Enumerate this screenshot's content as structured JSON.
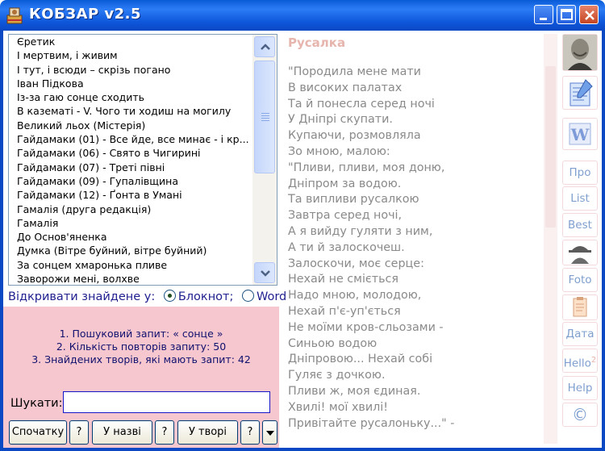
{
  "window": {
    "title": "КОБЗАР v2.5"
  },
  "list": {
    "items": [
      "Єретик",
      "І мертвим, і живим",
      "І тут, і всюди – скрізь погано",
      "Іван Підкова",
      "Із-за гаю сонце сходить",
      "В казематі - V. Чого ти ходиш на могилу",
      "Великий льох (Містерія)",
      "Гайдамаки (01) - Все йде, все минає - і кр...",
      "Гайдамаки (06) - Свято в Чигирині",
      "Гайдамаки (07) - Треті півні",
      "Гайдамаки (09) - Гупалівщина",
      "Гайдамаки (12) - Ґонта в Умані",
      "Гамалія (друга редакція)",
      "Гамалія",
      "До Основ'яненка",
      "Думка (Вітре буйний, вітре буйний)",
      "За сонцем хмаронька пливе",
      "Заворожи мені, волхве"
    ]
  },
  "open_with": {
    "label": "Відкривати знайдене у:",
    "options": [
      "Блокнот;",
      "Word"
    ],
    "selected": "Блокнот;"
  },
  "stats": {
    "line1": "1. Пошуковий запит: « сонце »",
    "line2": "2. Кількість повторів запиту: 50",
    "line3": "3. Знайдених творів, які мають запит: 42"
  },
  "search": {
    "label": "Шукати:",
    "value": ""
  },
  "buttons": {
    "from_start": "Спочатку",
    "help": "?",
    "in_title": "У назві",
    "in_work": "У творі",
    "menu_arrow": "▾"
  },
  "poem": {
    "title": "Русалка",
    "lines": [
      "\"Породила мене мати",
      "В високих палатах",
      "Та й понесла серед ночі",
      "У Дніпрі скупати.",
      "Купаючи, розмовляла",
      "Зо мною, малою:",
      "\"Пливи, пливи, моя доню,",
      "Дніпром за водою.",
      "Та випливи русалкою",
      "Завтра серед ночі,",
      "А я вийду гуляти з ним,",
      "А ти й залоскочеш.",
      "Залоскочи, моє серце:",
      "Нехай не сміється",
      "Надо мною, молодою,",
      "Нехай п'є-уп'ється",
      "Не моїми кров-сльозами -",
      "Синьою водою",
      "Дніпровою... Нехай собі",
      "Гуляє з дочкою.",
      "Пливи ж, моя єдиная.",
      "Хвилі! мої хвилі!",
      "Привітайте русалоньку...\" -"
    ]
  },
  "toolbar": {
    "about": "Про",
    "list": "List",
    "best": "Best",
    "foto": "Foto",
    "date": "Дата",
    "hello": "Hello",
    "hello_sup": "2",
    "help": "Help",
    "copyright": "©"
  },
  "colors": {
    "titlebar": "#0a5bd6",
    "panel_pink": "#f7c7cf",
    "poem_text": "#8a8a8a",
    "poem_title": "#e6b5ad",
    "toolbar_text": "#7f9fcf"
  }
}
